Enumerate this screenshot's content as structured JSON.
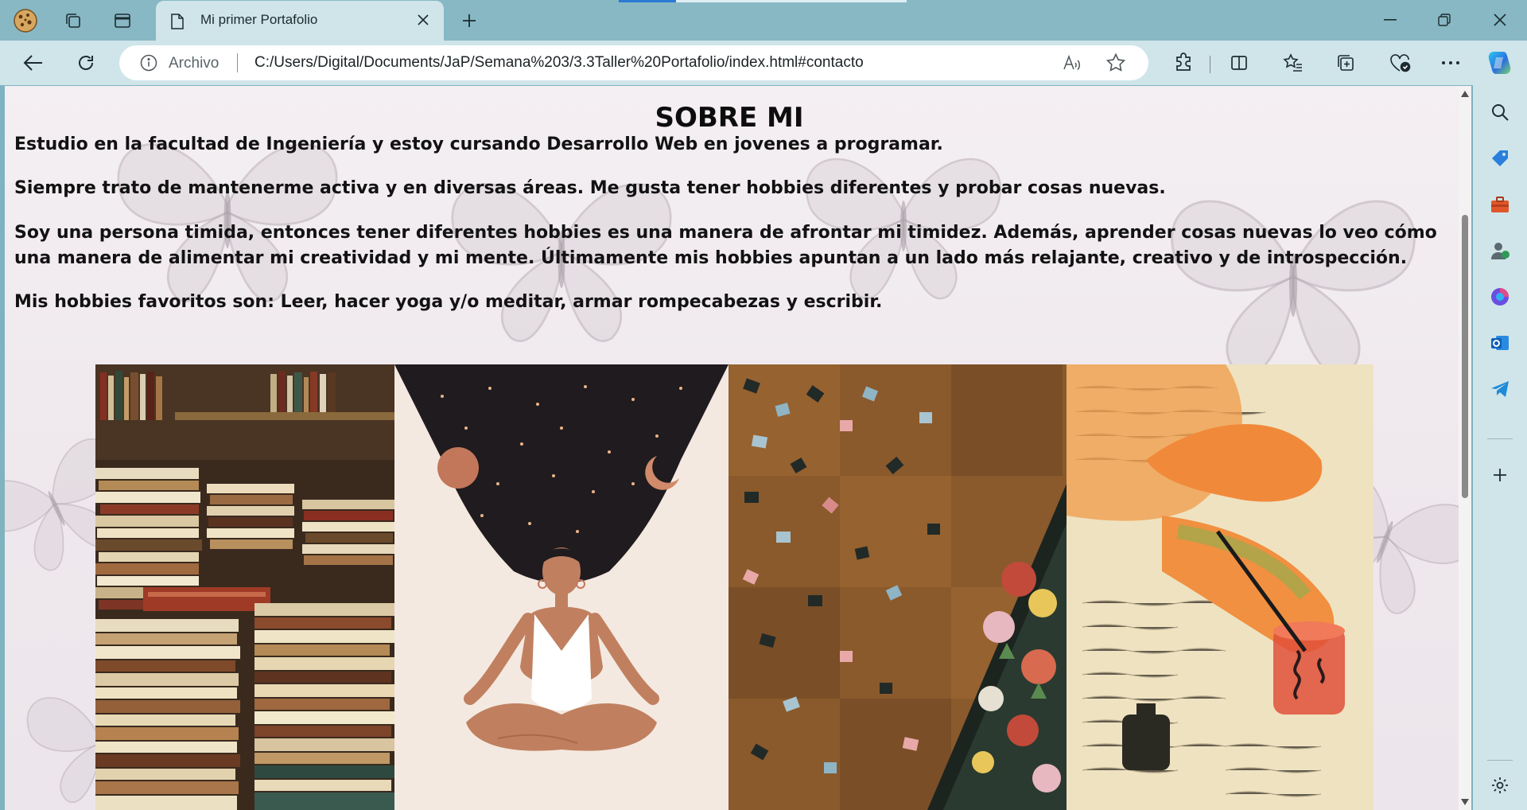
{
  "browser": {
    "tab_title": "Mi primer Portafolio",
    "address_label": "Archivo",
    "url": "C:/Users/Digital/Documents/JaP/Semana%203/3.3Taller%20Portafolio/index.html#contacto",
    "load_progress": 0.2
  },
  "icons": {
    "titlebar": [
      "cookie-icon",
      "workspaces-icon",
      "vertical-tabs-icon"
    ],
    "toolbar": [
      "back-icon",
      "refresh-icon",
      "info-icon",
      "read-aloud-icon",
      "favorite-star-icon",
      "extensions-icon",
      "split-screen-icon",
      "favorites-icon",
      "collections-icon",
      "browser-essentials-icon",
      "more-icon",
      "copilot-icon"
    ],
    "sidebar": [
      "search-icon",
      "shopping-tag-icon",
      "tools-icon",
      "people-icon",
      "copilot-app-icon",
      "outlook-icon",
      "telegram-icon",
      "add-icon",
      "settings-icon"
    ]
  },
  "page": {
    "title": "SOBRE MI",
    "paragraphs": [
      "Estudio en la facultad de Ingeniería y estoy cursando Desarrollo Web en jovenes a programar.",
      "Siempre trato de mantenerme activa y en diversas áreas. Me gusta tener hobbies diferentes y probar cosas nuevas.",
      "Soy una persona timida, entonces tener diferentes hobbies es una manera de afrontar mi timidez. Además, aprender cosas nuevas lo veo cómo una manera de alimentar mi creatividad y mi mente. Últimamente mis hobbies apuntan a un lado más relajante, creativo y de introspección.",
      "Mis hobbies favoritos son: Leer, hacer yoga y/o meditar, armar rompecabezas y escribir."
    ],
    "photos": [
      "books-photo",
      "meditation-illustration",
      "puzzle-photo",
      "writing-illustration"
    ]
  },
  "colors": {
    "titlebar": "#87b8c4",
    "toolbar": "#cfe5ea",
    "accent": "#2b7bd4"
  }
}
